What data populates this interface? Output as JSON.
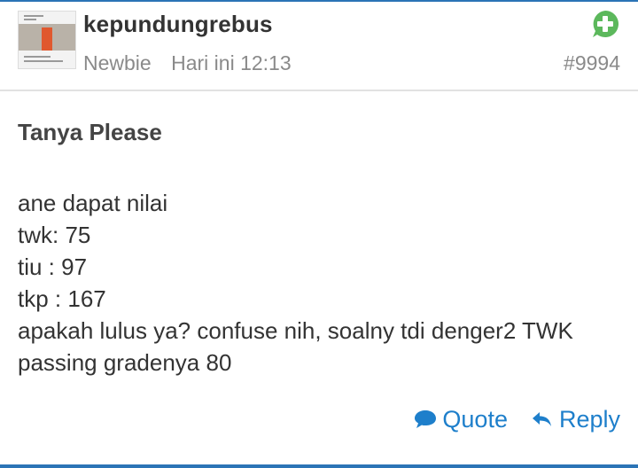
{
  "post": {
    "username": "kepundungrebus",
    "rank": "Newbie",
    "time": "Hari ini 12:13",
    "number": "#9994",
    "title": "Tanya Please",
    "body_lines": [
      "ane dapat nilai",
      "twk: 75",
      "tiu : 97",
      "tkp : 167",
      "apakah lulus ya? confuse nih, soalny tdi denger2 TWK",
      "passing gradenya 80"
    ]
  },
  "actions": {
    "quote_label": "Quote",
    "reply_label": "Reply"
  },
  "icons": {
    "add": "plus-circle-icon",
    "quote": "speech-bubble-icon",
    "reply": "reply-arrow-icon"
  },
  "colors": {
    "accent": "#2b74b6",
    "link": "#1e7fcb",
    "add_icon": "#5cb85c",
    "muted": "#8a8a8a"
  }
}
